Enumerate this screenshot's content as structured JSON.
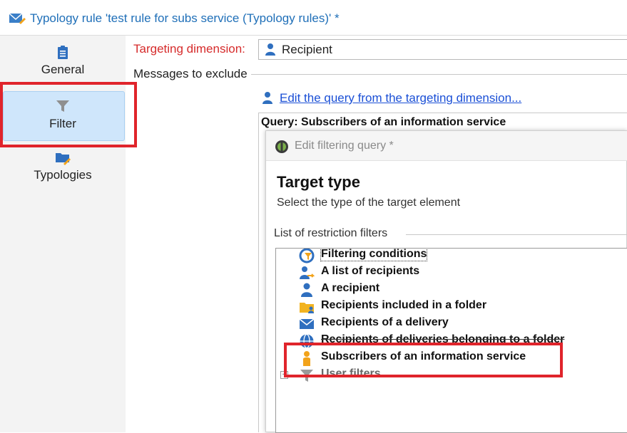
{
  "window": {
    "title": "Typology rule 'test rule for subs service (Typology rules)' *",
    "title_icon": "envelope-edit-icon"
  },
  "sidebar": {
    "items": [
      {
        "label": "General",
        "icon": "clipboard-icon",
        "selected": false
      },
      {
        "label": "Filter",
        "icon": "funnel-icon",
        "selected": true
      },
      {
        "label": "Typologies",
        "icon": "folder-edit-icon",
        "selected": false
      }
    ]
  },
  "main": {
    "targeting_label": "Targeting dimension:",
    "targeting_value": "Recipient",
    "exclude_label": "Messages to exclude",
    "edit_link": "Edit the query from the targeting dimension...",
    "query_title": "Query: Subscribers of an information service"
  },
  "dialog": {
    "title": "Edit filtering query *",
    "heading": "Target type",
    "subheading": "Select the type of the target element",
    "list_label": "List of restriction filters",
    "items": [
      {
        "label": "Filtering conditions",
        "icon": "filter-conditions-icon"
      },
      {
        "label": "A list of recipients",
        "icon": "recipient-list-icon"
      },
      {
        "label": "A recipient",
        "icon": "recipient-icon"
      },
      {
        "label": "Recipients included in a folder",
        "icon": "folder-icon"
      },
      {
        "label": "Recipients of a delivery",
        "icon": "envelope-icon"
      },
      {
        "label": "Recipients of deliveries belonging to a folder",
        "icon": "globe-icon"
      },
      {
        "label": "Subscribers of an information service",
        "icon": "subscriber-icon",
        "selected": true
      },
      {
        "label": "User filters",
        "icon": "funnel-icon",
        "expandable": true
      }
    ]
  },
  "colors": {
    "accent_blue": "#1f6fb8",
    "link_blue": "#1a4fd6",
    "required_red": "#d62b2b",
    "highlight_red": "#e0242b",
    "selected_bg": "#cfe6fb"
  }
}
